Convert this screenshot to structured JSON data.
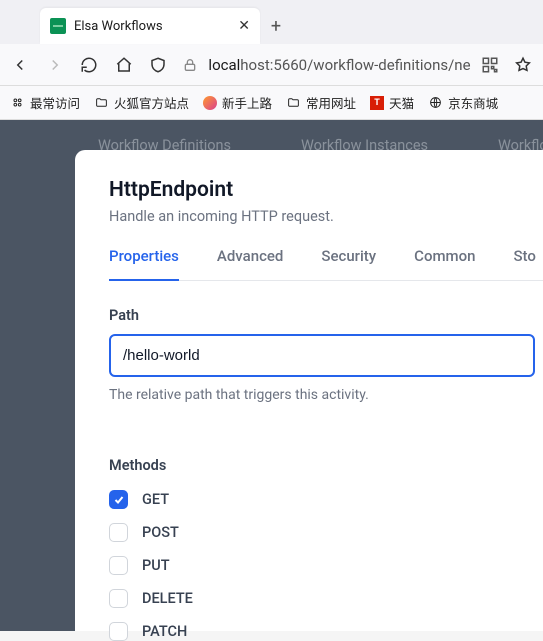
{
  "browser": {
    "tab_title": "Elsa Workflows",
    "address": {
      "host": "local",
      "rest": "host:5660/workflow-definitions/ne"
    },
    "bookmarks": {
      "frequent": "最常访问",
      "firefox_official": "火狐官方站点",
      "newbie": "新手上路",
      "common": "常用网址",
      "tmall": "天猫",
      "jd": "京东商城"
    }
  },
  "app_nav": {
    "item0": "Workflow Definitions",
    "item1": "Workflow Instances",
    "item2": "Workflow P"
  },
  "panel": {
    "title": "HttpEndpoint",
    "subtitle": "Handle an incoming HTTP request.",
    "tabs": {
      "t0": "Properties",
      "t1": "Advanced",
      "t2": "Security",
      "t3": "Common",
      "t4": "Sto"
    },
    "path": {
      "label": "Path",
      "value": "/hello-world",
      "help": "The relative path that triggers this activity."
    },
    "methods": {
      "label": "Methods",
      "items": {
        "m0": "GET",
        "m1": "POST",
        "m2": "PUT",
        "m3": "DELETE",
        "m4": "PATCH"
      }
    }
  }
}
